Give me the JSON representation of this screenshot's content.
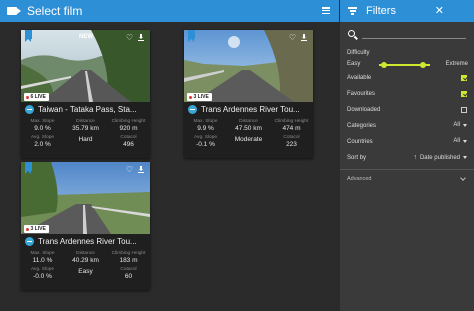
{
  "app": {
    "title": "Select film"
  },
  "filters": {
    "title": "Filters",
    "close_glyph": "✕",
    "search": {
      "value": ""
    },
    "difficulty": {
      "label": "Difficulty",
      "min_label": "Easy",
      "max_label": "Extreme",
      "range": [
        0.1,
        0.85
      ]
    },
    "available": {
      "label": "Available",
      "checked": true
    },
    "favourites": {
      "label": "Favourites",
      "checked": true
    },
    "downloaded": {
      "label": "Downloaded",
      "checked": false
    },
    "categories": {
      "label": "Categories",
      "value": "All"
    },
    "countries": {
      "label": "Countries",
      "value": "All"
    },
    "sort": {
      "label": "Sort by",
      "value": "Date published"
    },
    "advanced": {
      "label": "Advanced"
    }
  },
  "colors": {
    "accent": "#2d8fd5",
    "highlight": "#cde82e",
    "live": "#e03a2e"
  },
  "stat_labels": {
    "slope": "Max. Slope",
    "distance": "Distance",
    "height": "Climbing Height",
    "avg": "Avg. Slope",
    "difficulty": "",
    "cotacol": "Cotacol"
  },
  "films": [
    {
      "badge": "NEW",
      "live": "6 LIVE",
      "title": "Taiwan - Tataka Pass, Sta...",
      "max_slope": "9.0 %",
      "distance": "35.79 km",
      "climbing_height": "920 m",
      "avg_slope": "2.0 %",
      "difficulty": "Hard",
      "cotacol": "496"
    },
    {
      "badge": "",
      "live": "3 LIVE",
      "title": "Trans Ardennes River Tou...",
      "max_slope": "9.9 %",
      "distance": "47.50 km",
      "climbing_height": "474 m",
      "avg_slope": "-0.1 %",
      "difficulty": "Moderate",
      "cotacol": "223"
    },
    {
      "badge": "",
      "live": "3 LIVE",
      "title": "Trans Ardennes River Tou...",
      "max_slope": "11.0 %",
      "distance": "40.29 km",
      "climbing_height": "183 m",
      "avg_slope": "-0.0 %",
      "difficulty": "Easy",
      "cotacol": "60"
    }
  ]
}
